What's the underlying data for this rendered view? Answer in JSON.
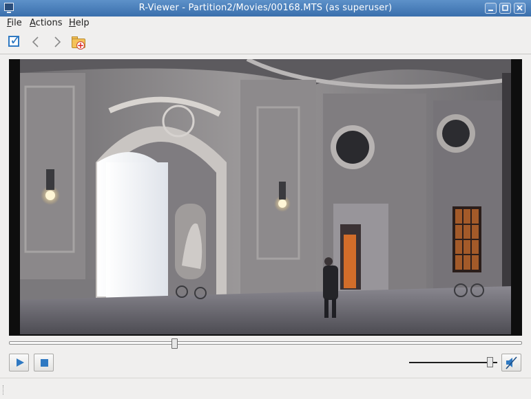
{
  "window": {
    "title": "R-Viewer - Partition2/Movies/00168.MTS (as superuser)",
    "icon": "monitor-icon",
    "controls": [
      "minimize-icon",
      "maximize-icon",
      "close-icon"
    ]
  },
  "menu": {
    "items": [
      {
        "label": "File"
      },
      {
        "label": "Actions"
      },
      {
        "label": "Help"
      }
    ]
  },
  "toolbar": {
    "buttons": [
      {
        "icon": "checkbox-icon",
        "state": "checked"
      },
      {
        "icon": "chevron-left-icon",
        "state": "disabled"
      },
      {
        "icon": "chevron-right-icon",
        "state": "disabled"
      },
      {
        "icon": "folder-recover-icon"
      }
    ]
  },
  "player": {
    "content": "video frame",
    "seek_position": 0.32,
    "volume_level": 0.95,
    "muted": true,
    "buttons": [
      {
        "icon": "play-icon"
      },
      {
        "icon": "stop-icon"
      },
      {
        "icon": "speaker-muted-icon"
      }
    ]
  },
  "colors": {
    "titlebar": "#4a7dba",
    "accent": "#2f79c2",
    "background": "#f0efee"
  }
}
